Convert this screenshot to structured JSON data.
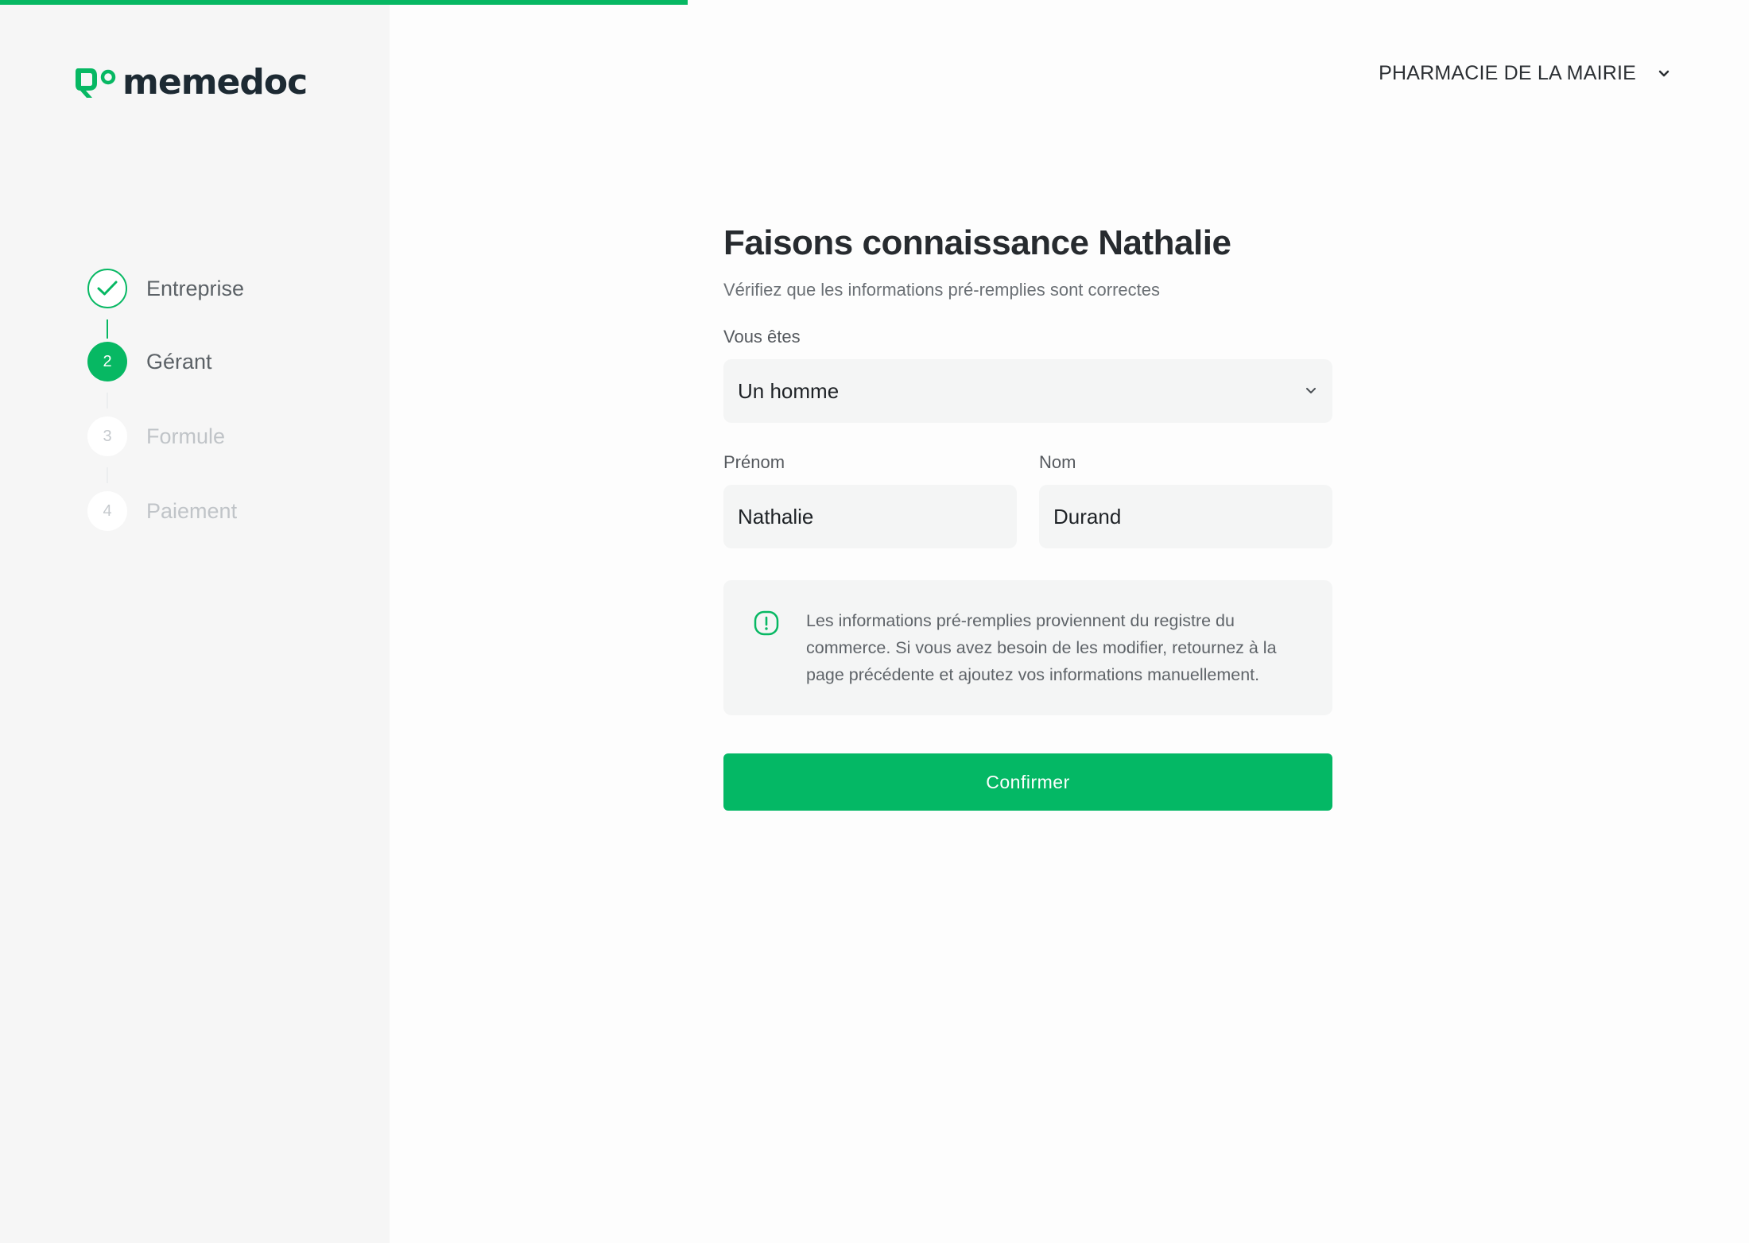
{
  "progress": {
    "percent": 39.3
  },
  "brand": {
    "name": "memedoc",
    "color": "#07b863"
  },
  "account": {
    "pharmacy_name": "PHARMACIE DE LA MAIRIE",
    "icon": "chevron-down-icon"
  },
  "steps": [
    {
      "number": "",
      "label": "Entreprise",
      "status": "done",
      "icon": "check-icon"
    },
    {
      "number": "2",
      "label": "Gérant",
      "status": "active"
    },
    {
      "number": "3",
      "label": "Formule",
      "status": "todo"
    },
    {
      "number": "4",
      "label": "Paiement",
      "status": "todo"
    }
  ],
  "form": {
    "title": "Faisons connaissance Nathalie",
    "subtitle": "Vérifiez que les informations pré-remplies sont correctes",
    "sex": {
      "label": "Vous êtes",
      "value": "Un homme"
    },
    "first_name": {
      "label": "Prénom",
      "value": "Nathalie"
    },
    "last_name": {
      "label": "Nom",
      "value": "Durand"
    },
    "notice": "Les informations pré-remplies proviennent du registre du commerce. Si vous avez besoin de les modifier, retournez à la page précédente et ajoutez vos informations manuellement.",
    "notice_icon": "alert-icon",
    "confirm_label": "Confirmer"
  }
}
